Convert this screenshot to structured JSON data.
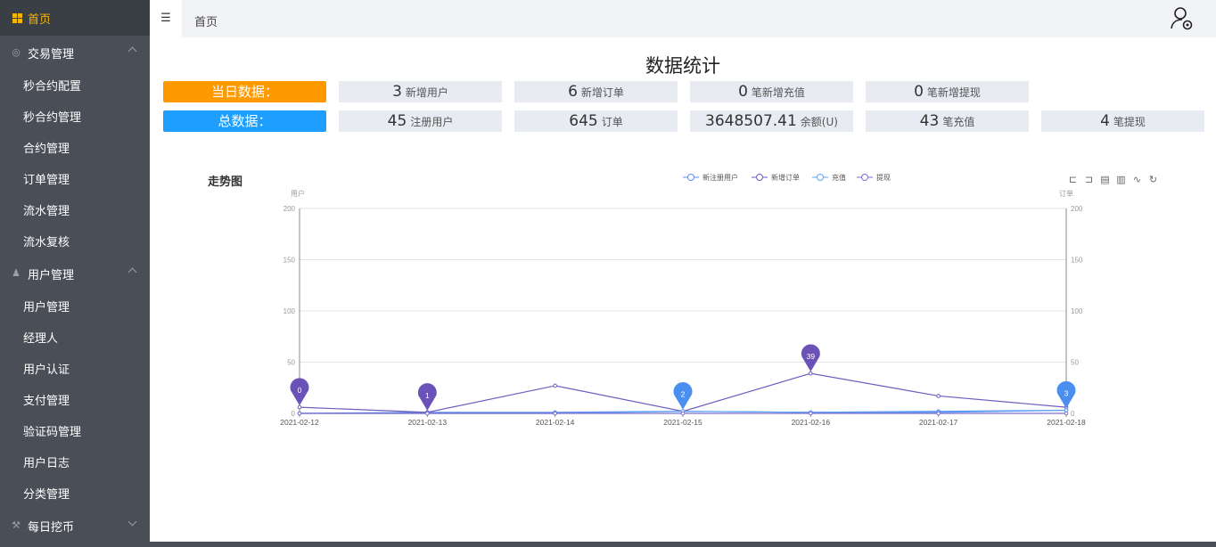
{
  "sidebar": {
    "home": "首页",
    "groups": [
      {
        "label": "交易管理",
        "items": [
          "秒合约配置",
          "秒合约管理",
          "合约管理",
          "订单管理",
          "流水管理",
          "流水复核"
        ]
      },
      {
        "label": "用户管理",
        "items": [
          "用户管理",
          "经理人",
          "用户认证",
          "支付管理",
          "验证码管理",
          "用户日志",
          "分类管理"
        ]
      },
      {
        "label": "每日挖币",
        "items": []
      }
    ]
  },
  "topbar": {
    "breadcrumb": "首页"
  },
  "page": {
    "title": "数据统计"
  },
  "today": {
    "label": "当日数据：",
    "stats": [
      {
        "value": "3",
        "label": "新增用户"
      },
      {
        "value": "6",
        "label": "新增订单"
      },
      {
        "value": "0",
        "label": "笔新增充值"
      },
      {
        "value": "0",
        "label": "笔新增提现"
      }
    ]
  },
  "total": {
    "label": "总数据：",
    "stats": [
      {
        "value": "45",
        "label": "注册用户"
      },
      {
        "value": "645",
        "label": "订单"
      },
      {
        "value": "3648507.41",
        "label": "余额(U)"
      },
      {
        "value": "43",
        "label": "笔充值"
      },
      {
        "value": "4",
        "label": "笔提现"
      }
    ]
  },
  "chart_data": {
    "type": "line",
    "title": "走势图",
    "ylabel_left": "用户",
    "ylabel_right": "订单",
    "ylim": [
      0,
      200
    ],
    "yticks": [
      0,
      50,
      100,
      150,
      200
    ],
    "categories": [
      "2021-02-12",
      "2021-02-13",
      "2021-02-14",
      "2021-02-15",
      "2021-02-16",
      "2021-02-17",
      "2021-02-18"
    ],
    "series": [
      {
        "name": "新注册用户",
        "color": "#5b8ff9",
        "values": [
          0,
          1,
          1,
          2,
          1,
          2,
          3
        ]
      },
      {
        "name": "新增订单",
        "color": "#6f5cc0",
        "values": [
          6,
          1,
          27,
          2,
          39,
          17,
          6
        ]
      },
      {
        "name": "充值",
        "color": "#5aa0f5",
        "values": [
          0,
          0,
          0,
          2,
          1,
          1,
          3
        ]
      },
      {
        "name": "提现",
        "color": "#7b6fd0",
        "values": [
          0,
          0,
          0,
          0,
          0,
          0,
          0
        ]
      }
    ],
    "markpoints": [
      {
        "x": "2021-02-12",
        "label": "0",
        "y": 6,
        "color": "#6a52b8"
      },
      {
        "x": "2021-02-13",
        "label": "1",
        "y": 1,
        "color": "#6a52b8"
      },
      {
        "x": "2021-02-15",
        "label": "2",
        "y": 2,
        "color": "#4a8ff0"
      },
      {
        "x": "2021-02-16",
        "label": "39",
        "y": 39,
        "color": "#6a52b8"
      },
      {
        "x": "2021-02-18",
        "label": "3",
        "y": 3,
        "color": "#4a8ff0"
      }
    ],
    "legend_position": "top-center",
    "grid": true
  }
}
